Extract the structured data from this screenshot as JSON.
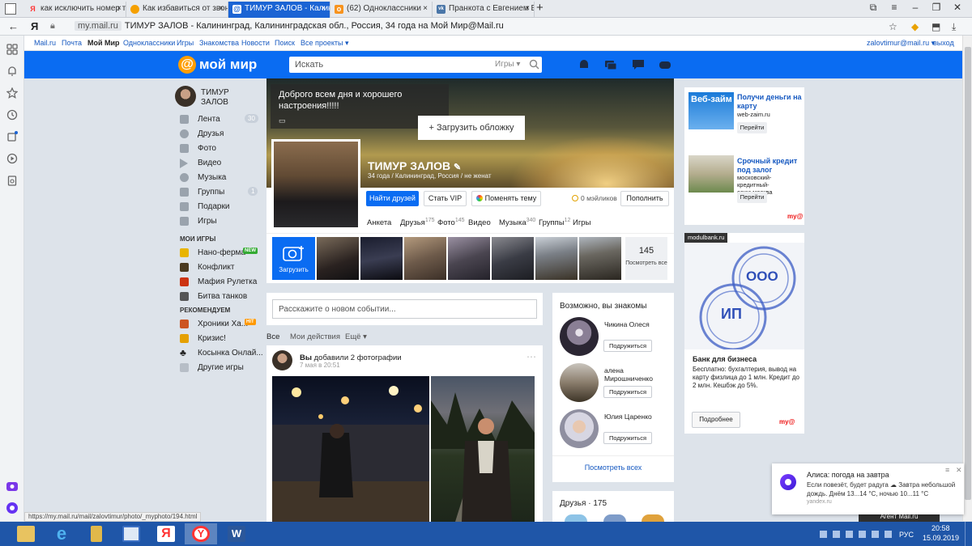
{
  "browser": {
    "tabs": [
      {
        "title": "как исключить номер теле",
        "favicon": "Я",
        "color": "#f33"
      },
      {
        "title": "Как избавиться от звонко",
        "favicon": "",
        "color": "#f5a000"
      },
      {
        "title": "ТИМУР ЗАЛОВ - Калинин",
        "favicon": "@",
        "color": "#fff"
      },
      {
        "title": "(62) Одноклассники",
        "favicon": "о",
        "color": "#f7931e"
      },
      {
        "title": "Пранкота с Евгением Воль",
        "favicon": "vk",
        "color": "#4a76a8"
      }
    ],
    "url_host": "my.mail.ru",
    "url_title": "ТИМУР ЗАЛОВ - Калининград, Калининградская обл., Россия, 34 года на Мой Мир@Mail.ru",
    "status_url": "https://my.mail.ru/mail/zalovtimur/photo/_myphoto/194.html"
  },
  "portal": {
    "links": [
      "Mail.ru",
      "Почта",
      "Мой Мир",
      "Одноклассники",
      "Игры",
      "Знакомства",
      "Новости",
      "Поиск",
      "Все проекты ▾"
    ],
    "user_email": "zalovtimur@mail.ru ▾",
    "logout": "выход"
  },
  "header": {
    "logo_symbol": "@",
    "logo_text": "мой мир",
    "search_placeholder": "Искать",
    "search_category": "Игры ▾"
  },
  "leftnav": {
    "user_name": "ТИМУР ЗАЛОВ",
    "items": [
      {
        "label": "Лента",
        "badge": "30"
      },
      {
        "label": "Друзья",
        "badge": ""
      },
      {
        "label": "Фото",
        "badge": ""
      },
      {
        "label": "Видео",
        "badge": ""
      },
      {
        "label": "Музыка",
        "badge": ""
      },
      {
        "label": "Группы",
        "badge": "1"
      },
      {
        "label": "Подарки",
        "badge": ""
      },
      {
        "label": "Игры",
        "badge": ""
      }
    ],
    "my_games_title": "МОИ ИГРЫ",
    "my_games": [
      {
        "label": "Нано-ферма",
        "tag": "NEW"
      },
      {
        "label": "Конфликт",
        "tag": ""
      },
      {
        "label": "Мафия Рулетка",
        "tag": ""
      },
      {
        "label": "Битва танков",
        "tag": ""
      }
    ],
    "recommend_title": "РЕКОМЕНДУЕМ",
    "recommend": [
      {
        "label": "Хроники Ха...",
        "tag": "HIT"
      },
      {
        "label": "Кризис!",
        "tag": ""
      },
      {
        "label": "Косынка Онлай...",
        "tag": ""
      },
      {
        "label": "Другие игры",
        "tag": ""
      }
    ]
  },
  "cover": {
    "status_text": "Доброго всем дня и хорошего настроения!!!!!",
    "upload_cover": "+ Загрузить обложку"
  },
  "profile": {
    "name": "ТИМУР ЗАЛОВ",
    "subtitle": "34 года / Калининград, Россия / не женат",
    "btn_find_friends": "Найти друзей",
    "btn_vip": "Стать VIP",
    "btn_theme": "Поменять тему",
    "coins": "0 мэйликов",
    "btn_replenish": "Пополнить",
    "tabs": [
      {
        "label": "Анкета",
        "count": ""
      },
      {
        "label": "Друзья",
        "count": "175"
      },
      {
        "label": "Фото",
        "count": "145"
      },
      {
        "label": "Видео",
        "count": ""
      },
      {
        "label": "Музыка",
        "count": "340"
      },
      {
        "label": "Группы",
        "count": "12"
      },
      {
        "label": "Игры",
        "count": ""
      }
    ]
  },
  "photos": {
    "upload_label": "Загрузить",
    "count": "145",
    "count_label": "Посмотреть все"
  },
  "feed": {
    "event_placeholder": "Расскажите о новом событии...",
    "tabs": [
      "Все",
      "Мои действия",
      "Ещё ▾"
    ],
    "post_author": "Вы",
    "post_action": " добавили 2 фотографии",
    "post_time": "7 мая в 20:51"
  },
  "suggestions": {
    "title": "Возможно, вы знакомы",
    "people": [
      {
        "name": "Чикина Олеся",
        "button": "Подружиться"
      },
      {
        "name": "алена Мирошниченко",
        "button": "Подружиться"
      },
      {
        "name": "Юлия Царенко",
        "button": "Подружиться"
      }
    ],
    "show_all": "Посмотреть всех",
    "friends_title": "Друзья · 175"
  },
  "ads": [
    {
      "badge": "Веб-займ",
      "title": "Получи деньги на карту",
      "sub": "web-zaim.ru",
      "button": "Перейти"
    },
    {
      "title": "Срочный кредит под залог",
      "sub": "московский-кредитный-союз.москва",
      "button": "Перейти"
    }
  ],
  "ad_brand": "my@",
  "bank": {
    "label": "modulbank.ru",
    "stamp1": "ООО",
    "stamp2": "ИП",
    "title": "Банк для бизнеса",
    "text": "Бесплатно: бухгалтерия, вывод на карту физлица до 1 млн. Кредит до 2 млн. Кешбэк до 5%.",
    "button": "Подробнее"
  },
  "notification": {
    "title": "Алиса: погода на завтра",
    "text": "Если повезёт, будет радуга ☁ Завтра небольшой дождь. Днём 13...14 °С, ночью 10...11 °С",
    "source": "yandex.ru",
    "behind": "Агент Mail.ru"
  },
  "taskbar": {
    "lang": "РУС",
    "time": "20:58",
    "date": "15.09.2019"
  }
}
